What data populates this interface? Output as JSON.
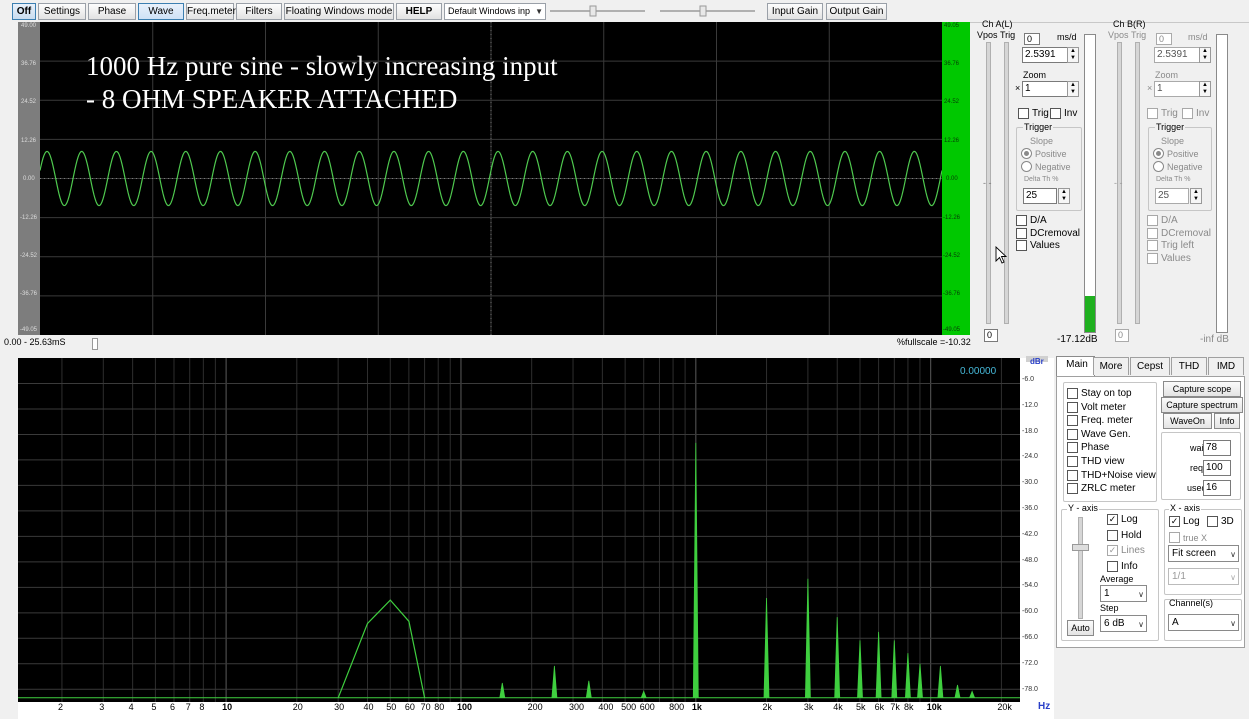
{
  "toolbar": {
    "buttons": [
      "Off",
      "Settings",
      "Phase",
      "Wave",
      "Freq.meter",
      "Filters",
      "Floating Windows mode",
      "HELP"
    ],
    "windows_mode": "Default Windows inp",
    "input_gain": "Input Gain",
    "output_gain": "Output Gain"
  },
  "scope": {
    "title_line1": "1000 Hz pure sine - slowly increasing input",
    "title_line2": "- 8 OHM SPEAKER ATTACHED",
    "y_ticks": [
      "49.00",
      "36.76",
      "24.52",
      "12.26",
      "0.00",
      "-12.26",
      "-24.52",
      "-36.76",
      "-49.05"
    ],
    "y_ticks_right": [
      "49.05",
      "36.76",
      "24.52",
      "12.26",
      "0.00",
      "-12.26",
      "-24.52",
      "-36.76",
      "-49.05"
    ],
    "time_range": "0.00 - 25.63mS",
    "fullscale": "%fullscale =-10.32",
    "wave_color": "#4fc94f",
    "wave_cycles": 26,
    "wave_amplitude_pct": 8.5
  },
  "chA": {
    "title": "Ch A(L)",
    "vpos": "Vpos",
    "trig": "Trig",
    "zero": "0",
    "msd_label": "ms/d",
    "msd_value": "2.5391",
    "zoom_label": "Zoom",
    "zoom_prefix": "×",
    "zoom_value": "1",
    "trig_chk": "Trig",
    "inv_chk": "Inv",
    "trigger_group": "Trigger",
    "slope": "Slope",
    "positive": "Positive",
    "negative": "Negative",
    "delta": "Delta Th %",
    "delta_value": "25",
    "da": "D/A",
    "dcremoval": "DCremoval",
    "values": "Values",
    "level_zero": "0",
    "level_db": "-17.12dB",
    "meter_fill": 0.12
  },
  "chB": {
    "title": "Ch B(R)",
    "vpos": "Vpos",
    "trig": "Trig",
    "zero": "0",
    "msd_label": "ms/d",
    "msd_value": "2.5391",
    "zoom_label": "Zoom",
    "zoom_prefix": "×",
    "zoom_value": "1",
    "trig_chk": "Trig",
    "inv_chk": "Inv",
    "trigger_group": "Trigger",
    "slope": "Slope",
    "positive": "Positive",
    "negative": "Negative",
    "delta": "Delta Th %",
    "delta_value": "25",
    "da": "D/A",
    "dcremoval": "DCremoval",
    "trigleft": "Trig left",
    "values": "Values",
    "level_zero": "0",
    "level_db": "-inf dB"
  },
  "spectrum": {
    "readout": "0.00000",
    "unit": "dBr",
    "hz": "Hz",
    "y_ticks": [
      "-6.0",
      "-12.0",
      "-18.0",
      "-24.0",
      "-30.0",
      "-36.0",
      "-42.0",
      "-48.0",
      "-54.0",
      "-60.0",
      "-66.0",
      "-72.0",
      "-78.0"
    ],
    "x_ticks": [
      {
        "t": "2",
        "f": 2
      },
      {
        "t": "3",
        "f": 3
      },
      {
        "t": "4",
        "f": 4
      },
      {
        "t": "5",
        "f": 5
      },
      {
        "t": "6",
        "f": 6
      },
      {
        "t": "7",
        "f": 7
      },
      {
        "t": "8",
        "f": 8
      },
      {
        "t": "10",
        "f": 10,
        "b": true
      },
      {
        "t": "20",
        "f": 20
      },
      {
        "t": "30",
        "f": 30
      },
      {
        "t": "40",
        "f": 40
      },
      {
        "t": "50",
        "f": 50
      },
      {
        "t": "60",
        "f": 60
      },
      {
        "t": "70",
        "f": 70
      },
      {
        "t": "80",
        "f": 80
      },
      {
        "t": "100",
        "f": 100,
        "b": true
      },
      {
        "t": "200",
        "f": 200
      },
      {
        "t": "300",
        "f": 300
      },
      {
        "t": "400",
        "f": 400
      },
      {
        "t": "500",
        "f": 500
      },
      {
        "t": "600",
        "f": 600
      },
      {
        "t": "800",
        "f": 800
      },
      {
        "t": "1k",
        "f": 1000,
        "b": true
      },
      {
        "t": "2k",
        "f": 2000
      },
      {
        "t": "3k",
        "f": 3000
      },
      {
        "t": "4k",
        "f": 4000
      },
      {
        "t": "5k",
        "f": 5000
      },
      {
        "t": "6k",
        "f": 6000
      },
      {
        "t": "7k",
        "f": 7000
      },
      {
        "t": "8k",
        "f": 8000
      },
      {
        "t": "10k",
        "f": 10000,
        "b": true
      },
      {
        "t": "20k",
        "f": 20000
      }
    ],
    "color": "#3fcf3f"
  },
  "chart_data": {
    "type": "line",
    "xlabel": "Hz",
    "ylabel": "dBr",
    "x_scale": "log",
    "xlim": [
      1.3,
      24000
    ],
    "ylim": [
      -81,
      0
    ],
    "grid": true,
    "floor_db": -80,
    "hump": [
      [
        30,
        -80
      ],
      [
        40,
        -62.5
      ],
      [
        50,
        -57
      ],
      [
        60,
        -62
      ],
      [
        70,
        -80
      ]
    ],
    "spikes": [
      {
        "f": 150,
        "db": -76.5
      },
      {
        "f": 250,
        "db": -72.5
      },
      {
        "f": 350,
        "db": -76
      },
      {
        "f": 600,
        "db": -78.5
      },
      {
        "f": 1000,
        "db": -20
      },
      {
        "f": 2000,
        "db": -56.5
      },
      {
        "f": 3000,
        "db": -52
      },
      {
        "f": 4000,
        "db": -61
      },
      {
        "f": 5000,
        "db": -66.5
      },
      {
        "f": 6000,
        "db": -64.5
      },
      {
        "f": 7000,
        "db": -66.5
      },
      {
        "f": 8000,
        "db": -69.5
      },
      {
        "f": 9000,
        "db": -72
      },
      {
        "f": 11000,
        "db": -72.5
      },
      {
        "f": 13000,
        "db": -77
      },
      {
        "f": 15000,
        "db": -78.5
      }
    ]
  },
  "bottom_panel": {
    "tabs": [
      "Main",
      "More",
      "Cepst",
      "THD",
      "IMD"
    ],
    "checks": [
      {
        "label": "Stay on top",
        "on": false
      },
      {
        "label": "Volt meter",
        "on": false
      },
      {
        "label": "Freq. meter",
        "on": false
      },
      {
        "label": "Wave Gen.",
        "on": false
      },
      {
        "label": "Phase",
        "on": false
      },
      {
        "label": "THD view",
        "on": false
      },
      {
        "label": "THD+Noise view",
        "on": false
      },
      {
        "label": "ZRLC meter",
        "on": false
      }
    ],
    "capture_scope": "Capture scope",
    "capture_spectrum": "Capture spectrum",
    "waveon": "WaveOn",
    "info": "Info",
    "wait_label": "wait",
    "wait": "78",
    "req_label": "req.",
    "req": "100",
    "used_label": "used",
    "used": "16",
    "yaxis": "Y - axis",
    "xaxis": "X - axis",
    "y_log": "Log",
    "y_hold": "Hold",
    "y_lines": "Lines",
    "y_info": "Info",
    "average_label": "Average",
    "average": "1",
    "step_label": "Step",
    "step": "6 dB",
    "auto": "Auto",
    "x_log": "Log",
    "x_3d": "3D",
    "truex": "true X",
    "fit": "Fit screen",
    "ratio": "1/1",
    "channels_label": "Channel(s)",
    "channel": "A"
  }
}
